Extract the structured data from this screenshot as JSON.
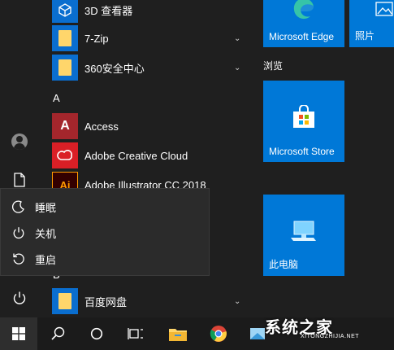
{
  "apps": [
    {
      "label": "3D 查看器",
      "type": "app"
    },
    {
      "label": "7-Zip",
      "type": "folder",
      "expandable": true
    },
    {
      "label": "360安全中心",
      "type": "folder",
      "expandable": true
    },
    {
      "label": "Access",
      "type": "app"
    },
    {
      "label": "Adobe Creative Cloud",
      "type": "app"
    },
    {
      "label": "Adobe Illustrator CC 2018",
      "type": "app"
    },
    {
      "label": "百度网盘",
      "type": "folder",
      "expandable": true
    }
  ],
  "section_letters": {
    "a": "A",
    "b": "B"
  },
  "tiles": {
    "edge": "Microsoft Edge",
    "photos": "照片",
    "group_title": "浏览",
    "store": "Microsoft Store",
    "this_pc": "此电脑"
  },
  "power_menu": [
    {
      "label": "睡眠",
      "icon": "moon-icon"
    },
    {
      "label": "关机",
      "icon": "power-icon"
    },
    {
      "label": "重启",
      "icon": "restart-icon"
    }
  ],
  "watermark": {
    "text": "系统之家",
    "sub": "XITONGZHIJIA.NET"
  },
  "colors": {
    "tile": "#0078d7",
    "background": "#1f1f1f",
    "menu": "#2b2b2b"
  }
}
